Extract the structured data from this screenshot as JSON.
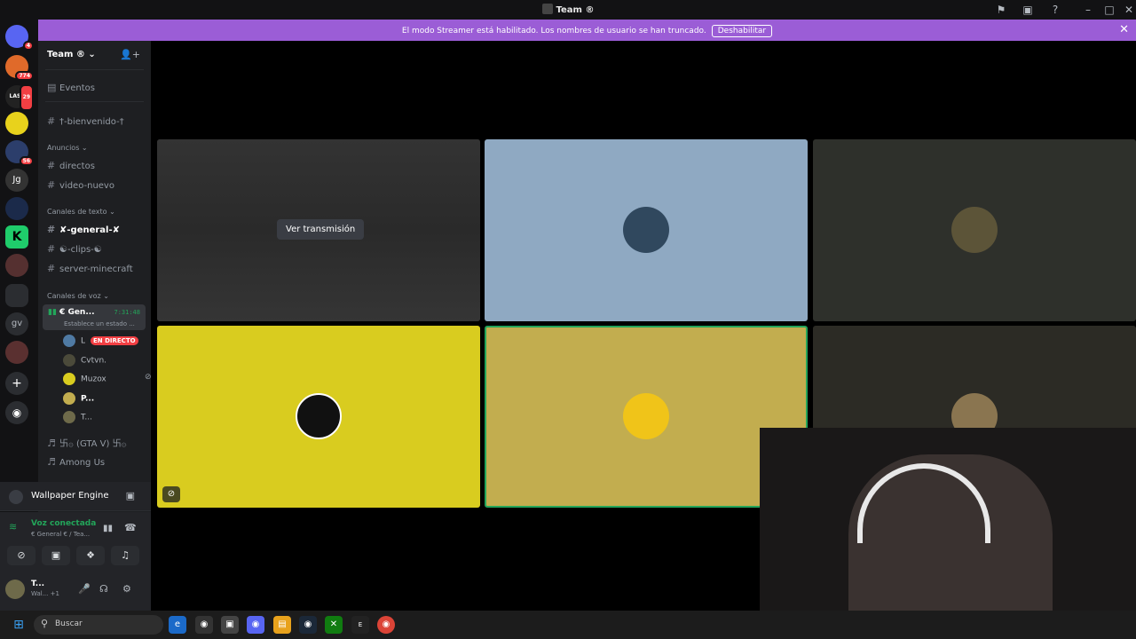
{
  "window": {
    "title": "Team ®"
  },
  "banner": {
    "message": "El modo Streamer está habilitado. Los nombres de usuario se han truncado.",
    "button": "Deshabilitar"
  },
  "guilds": [
    {
      "badge": "4"
    },
    {
      "badge": "774"
    },
    {
      "label": "LAST WAR",
      "badge": "29"
    },
    {
      "badge": ""
    },
    {
      "badge": "56"
    },
    {
      "label": "Jg"
    },
    {
      "label": ""
    },
    {
      "label": "K"
    },
    {
      "label": ""
    },
    {
      "label": ""
    },
    {
      "label": "gv"
    },
    {
      "label": ""
    }
  ],
  "server": {
    "name": "Team ®",
    "events": "Eventos",
    "welcome": "†-bienvenido-†",
    "cat_announcements": "Anuncios",
    "announcements": [
      "directos",
      "video-nuevo"
    ],
    "cat_text": "Canales de texto",
    "text_channels": [
      "✘-general-✘",
      "☯-clips-☯",
      "server-minecraft"
    ],
    "cat_voice": "Canales de voz",
    "active_voice": {
      "name": "€ Gen...",
      "time": "7:31:48",
      "status": "Establece un estado ..."
    },
    "voice_users": [
      {
        "name": "L",
        "live": "EN DIRECTO"
      },
      {
        "name": "Cvtvn."
      },
      {
        "name": "Muzox"
      },
      {
        "name": "P..."
      },
      {
        "name": "T..."
      }
    ],
    "voice_channels": [
      "卐۞ (GTA V) 卐۞",
      "Among Us"
    ]
  },
  "panels": {
    "activity": "Wallpaper Engine",
    "voice_connected": "Voz conectada",
    "voice_location": "€ General € / Tea...",
    "user_name": "T...",
    "user_status": "Wal... +1"
  },
  "stage": {
    "stream_button": "Ver transmisión",
    "tile_colors": [
      "#2b2b2b",
      "#8fa9c2",
      "#2e302b",
      "#d9cc1f",
      "#c2ad4f",
      "#2c2b25"
    ]
  },
  "taskbar": {
    "search_placeholder": "Buscar"
  }
}
